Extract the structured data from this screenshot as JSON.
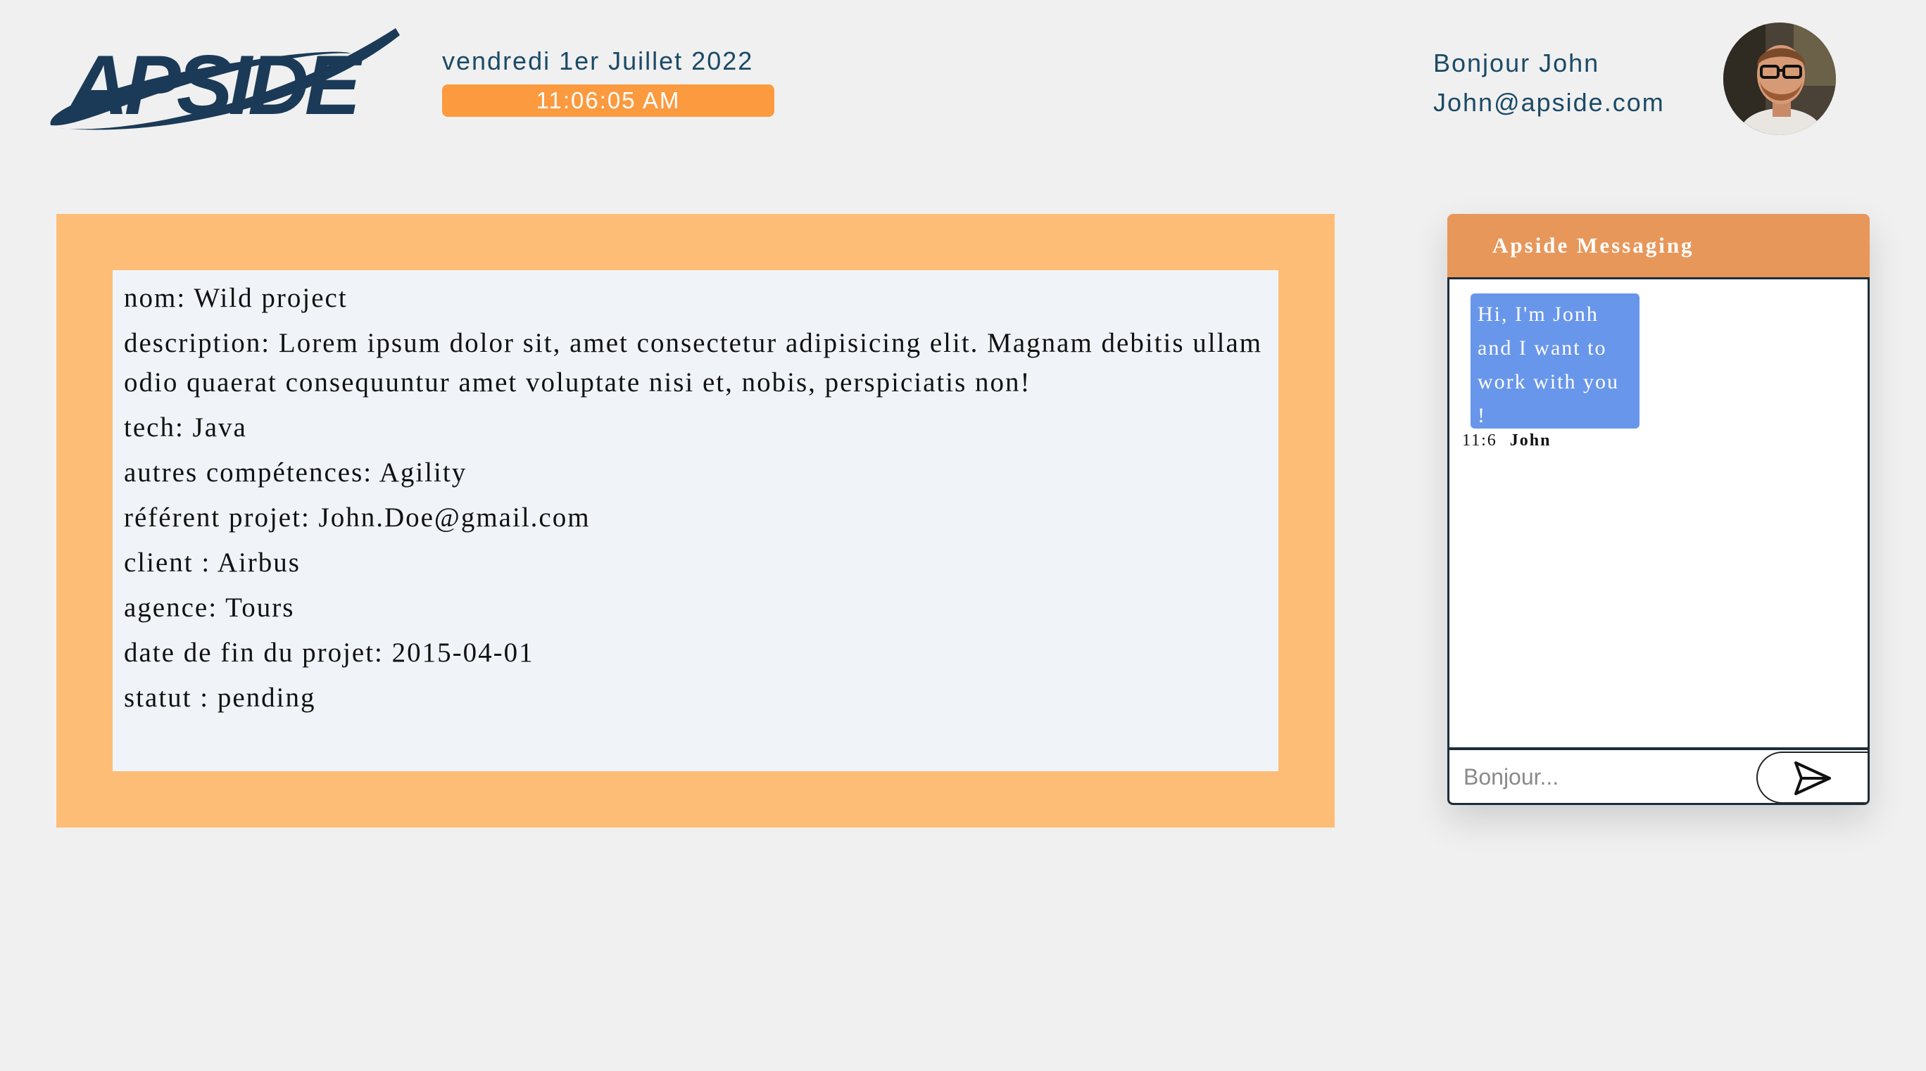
{
  "header": {
    "logo_text": "APSIDE",
    "date": "vendredi 1er Juillet 2022",
    "time": "11:06:05 AM",
    "greeting": "Bonjour John",
    "email": "John@apside.com",
    "avatar_icon": "user-avatar-photo"
  },
  "project": {
    "nom": "nom: Wild project",
    "description": "description: Lorem ipsum dolor sit, amet consectetur adipisicing elit. Magnam debitis ullam odio quaerat consequuntur amet voluptate nisi et, nobis, perspiciatis non!",
    "tech": "tech: Java",
    "autres": "autres compétences: Agility",
    "referent": "référent projet: John.Doe@gmail.com",
    "client": "client : Airbus",
    "agence": "agence: Tours",
    "date_fin": "date de fin du projet: 2015-04-01",
    "statut": "statut : pending"
  },
  "chat": {
    "title": "Apside Messaging",
    "messages": [
      {
        "text": "Hi, I'm Jonh and I want to work with you !",
        "time": "11:6",
        "author": "John"
      }
    ],
    "input_placeholder": "Bonjour...",
    "send_icon": "send-icon"
  },
  "colors": {
    "brand_navy": "#1b3a57",
    "accent_orange": "#fb9a3f",
    "frame_orange": "#fdbd76",
    "chat_header": "#e8975a",
    "bubble_blue": "#6896ea"
  }
}
